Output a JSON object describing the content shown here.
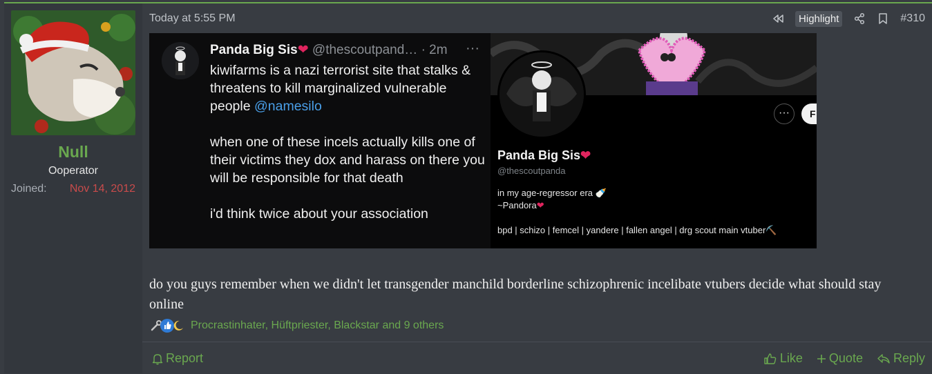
{
  "post": {
    "timestamp": "Today at 5:55 PM",
    "highlight_label": "Highlight",
    "post_number": "#310",
    "author": {
      "name": "Null",
      "title": "Ooperator",
      "joined_label": "Joined:",
      "joined_date": "Nov 14, 2012"
    },
    "embed": {
      "tweet_name": "Panda Big Sis",
      "tweet_heart": "❤",
      "tweet_handle": "@thescoutpand… · 2m",
      "tweet_more": "···",
      "tweet_line1": "kiwifarms is a nazi terrorist site that stalks & threatens to kill marginalized vulnerable people ",
      "tweet_mention": "@namesilo",
      "tweet_line2": "when one of these incels actually kills one of their victims they dox and harass on there you will be responsible for that death",
      "tweet_line3": "i'd think twice about your association",
      "profile_name": "Panda Big Sis",
      "profile_handle": "@thescoutpanda",
      "bio_line1": "in my age-regressor era 🍼",
      "bio_line2": "~Pandora",
      "bio_line3": "bpd | schizo | femcel | yandere | fallen angel | drg scout main vtuber⛏️",
      "dots": "···",
      "follow_initial": "F"
    },
    "message": "do you guys remember when we didn't let transgender manchild borderline schizophrenic incelibate vtubers decide what should stay online",
    "reactions": {
      "names": "Procrastinhater, Hüftpriester, Blackstar and 9 others",
      "icons": [
        "wrench-icon",
        "thumbs-up-icon",
        "moon-icon"
      ]
    },
    "footer": {
      "report": "Report",
      "like": "Like",
      "quote": "Quote",
      "reply": "Reply"
    }
  },
  "colors": {
    "accent": "#6aa84f",
    "background": "#383c42",
    "sidebar": "#33373d",
    "joined_date": "#c94b4b"
  }
}
